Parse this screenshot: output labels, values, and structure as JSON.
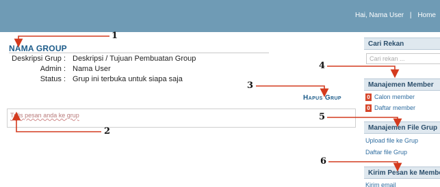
{
  "header": {
    "greeting": "Hai, Nama User",
    "separator": "|",
    "home_link": "Home"
  },
  "group": {
    "title": "NAMA GROUP",
    "rows": [
      {
        "label": "Deskripsi Grup :",
        "value": "Deskripsi / Tujuan Pembuatan Group"
      },
      {
        "label": "Admin :",
        "value": "Nama User"
      },
      {
        "label": "Status :",
        "value": "Grup ini terbuka untuk siapa saja"
      }
    ],
    "delete_link": "Hapus Grup",
    "message_placeholder": "Tulis pesan anda ke grup"
  },
  "sidebar": {
    "search": {
      "heading": "Cari Rekan",
      "placeholder": "Cari rekan ..."
    },
    "members": {
      "heading": "Manajemen Member",
      "items": [
        {
          "count": "0",
          "label": "Calon member"
        },
        {
          "count": "0",
          "label": "Daftar member"
        }
      ]
    },
    "files": {
      "heading": "Manajemen File Grup",
      "items": [
        "Upload file ke Grup",
        "Daftar file Grup"
      ]
    },
    "messages": {
      "heading": "Kirim Pesan ke Member",
      "items": [
        "Kirim email"
      ]
    }
  },
  "annotations": [
    "1",
    "2",
    "3",
    "4",
    "5",
    "6"
  ],
  "colors": {
    "topbar": "#6f9bb5",
    "title": "#1d5c8a",
    "badge": "#d6462a",
    "annotation_arrow": "#d43a1e"
  }
}
